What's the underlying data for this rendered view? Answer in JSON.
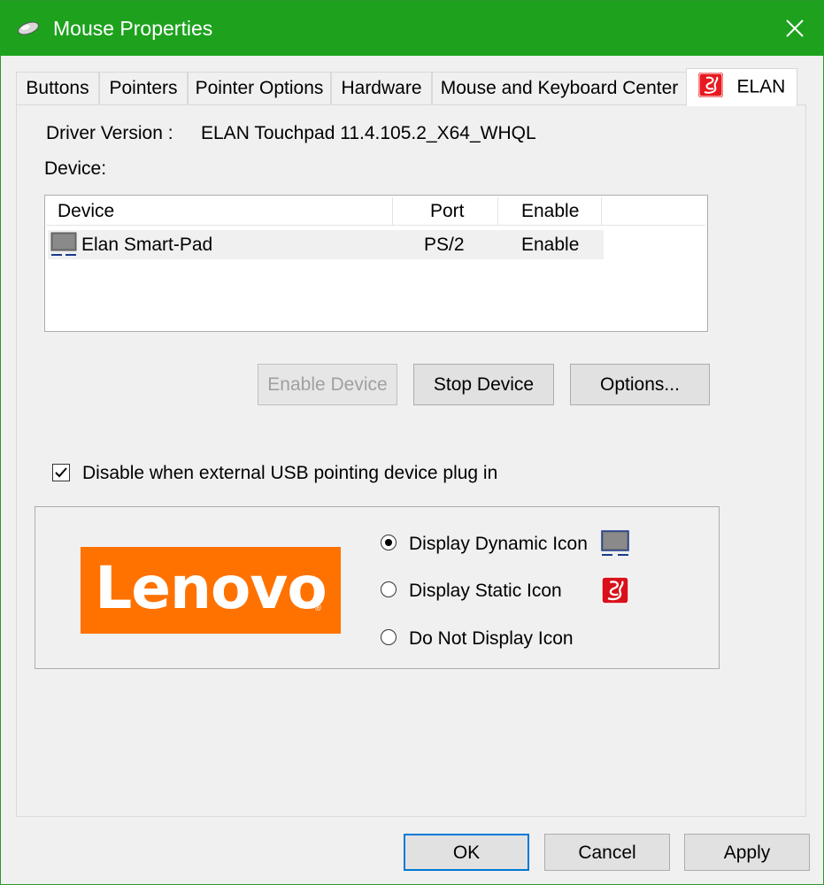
{
  "window": {
    "title": "Mouse Properties",
    "title_icon": "mouse-icon",
    "close_icon": "close-icon",
    "titlebar_color": "#1ea21e"
  },
  "tabs": [
    {
      "label": "Buttons",
      "active": false
    },
    {
      "label": "Pointers",
      "active": false
    },
    {
      "label": "Pointer Options",
      "active": false
    },
    {
      "label": "Hardware",
      "active": false
    },
    {
      "label": "Mouse and Keyboard Center",
      "active": false
    },
    {
      "label": "ELAN",
      "active": true,
      "icon": "elan-icon"
    }
  ],
  "elan": {
    "driver_version_label": "Driver Version :",
    "driver_version_value": "ELAN Touchpad 11.4.105.2_X64_WHQL",
    "device_label": "Device:",
    "device_list": {
      "columns": [
        "Device",
        "Port",
        "Enable"
      ],
      "rows": [
        {
          "device": "Elan Smart-Pad",
          "port": "PS/2",
          "enable": "Enable",
          "icon": "touchpad-icon"
        }
      ]
    },
    "buttons": {
      "enable_device": "Enable Device",
      "stop_device": "Stop Device",
      "options": "Options..."
    },
    "disable_checkbox": {
      "label": "Disable when external USB pointing device plug in",
      "checked": true
    },
    "logo_text": "Lenovo",
    "logo_color": "#ff7200",
    "icon_options": [
      {
        "label": "Display Dynamic Icon",
        "selected": true,
        "icon": "touchpad-icon"
      },
      {
        "label": "Display Static Icon",
        "selected": false,
        "icon": "elan-icon"
      },
      {
        "label": "Do Not Display Icon",
        "selected": false
      }
    ]
  },
  "footer": {
    "ok": "OK",
    "cancel": "Cancel",
    "apply": "Apply"
  }
}
